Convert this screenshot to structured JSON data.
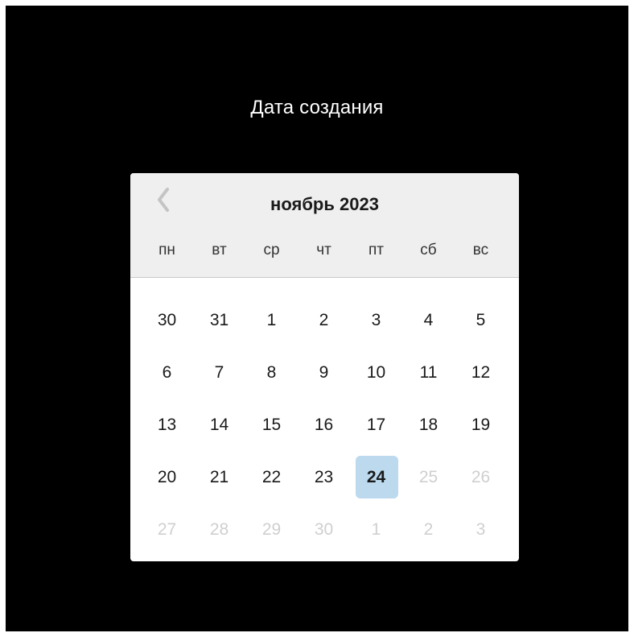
{
  "title": "Дата создания",
  "calendar": {
    "month_label": "ноябрь 2023",
    "prev_icon": "chevron-left-icon",
    "weekdays": [
      "пн",
      "вт",
      "ср",
      "чт",
      "пт",
      "сб",
      "вс"
    ],
    "selected_day": "24",
    "weeks": [
      [
        {
          "label": "30",
          "muted": false
        },
        {
          "label": "31",
          "muted": false
        },
        {
          "label": "1",
          "muted": false
        },
        {
          "label": "2",
          "muted": false
        },
        {
          "label": "3",
          "muted": false
        },
        {
          "label": "4",
          "muted": false
        },
        {
          "label": "5",
          "muted": false
        }
      ],
      [
        {
          "label": "6",
          "muted": false
        },
        {
          "label": "7",
          "muted": false
        },
        {
          "label": "8",
          "muted": false
        },
        {
          "label": "9",
          "muted": false
        },
        {
          "label": "10",
          "muted": false
        },
        {
          "label": "11",
          "muted": false
        },
        {
          "label": "12",
          "muted": false
        }
      ],
      [
        {
          "label": "13",
          "muted": false
        },
        {
          "label": "14",
          "muted": false
        },
        {
          "label": "15",
          "muted": false
        },
        {
          "label": "16",
          "muted": false
        },
        {
          "label": "17",
          "muted": false
        },
        {
          "label": "18",
          "muted": false
        },
        {
          "label": "19",
          "muted": false
        }
      ],
      [
        {
          "label": "20",
          "muted": false
        },
        {
          "label": "21",
          "muted": false
        },
        {
          "label": "22",
          "muted": false
        },
        {
          "label": "23",
          "muted": false
        },
        {
          "label": "24",
          "muted": false,
          "selected": true
        },
        {
          "label": "25",
          "muted": true
        },
        {
          "label": "26",
          "muted": true
        }
      ],
      [
        {
          "label": "27",
          "muted": true
        },
        {
          "label": "28",
          "muted": true
        },
        {
          "label": "29",
          "muted": true
        },
        {
          "label": "30",
          "muted": true
        },
        {
          "label": "1",
          "muted": true
        },
        {
          "label": "2",
          "muted": true
        },
        {
          "label": "3",
          "muted": true
        }
      ]
    ]
  },
  "colors": {
    "background": "#000000",
    "title_text": "#ffffff",
    "header_bg": "#efefef",
    "selected_bg": "#bcd9ee",
    "muted_text": "#cfcfcf",
    "prev_icon": "#c4c4c4"
  }
}
